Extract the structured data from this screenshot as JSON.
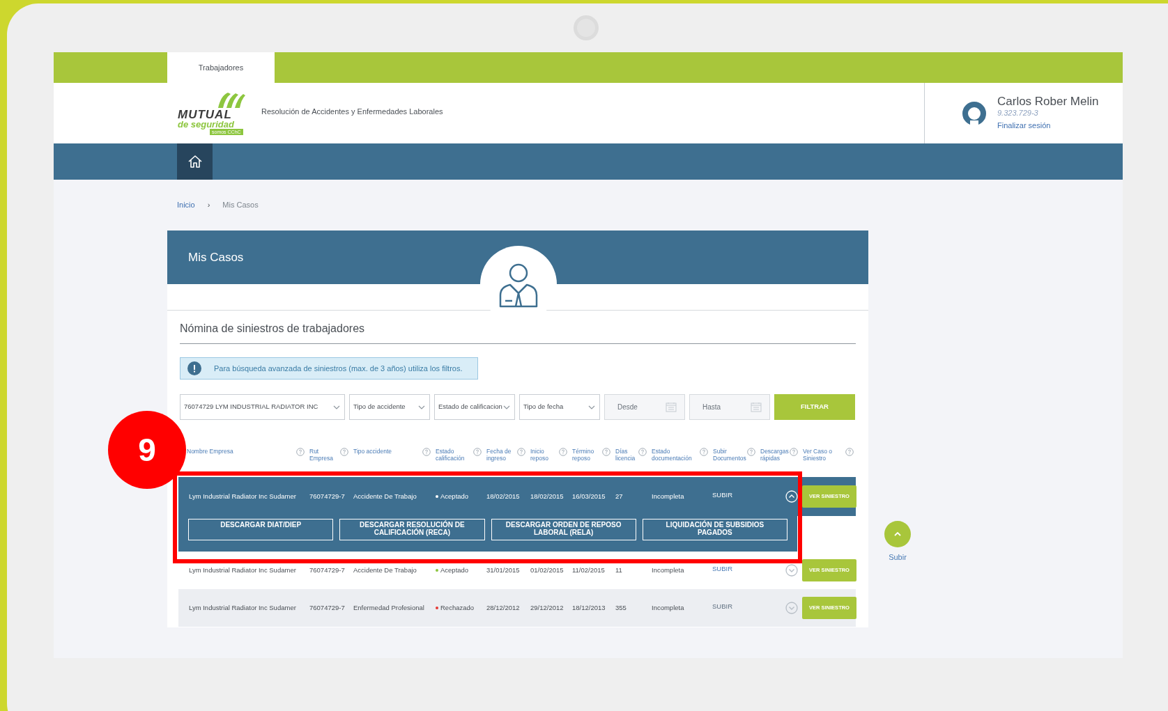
{
  "top_tab": {
    "label": "Trabajadores",
    "selected": true
  },
  "logo": {
    "word": "MUTUAL",
    "sub": "de seguridad",
    "tag": "somos CChC"
  },
  "header": {
    "subtitle": "Resolución de Accidentes y Enfermedades Laborales"
  },
  "user": {
    "name": "Carlos Rober Melin",
    "rut": "9.323.729-3",
    "logout": "Finalizar sesión"
  },
  "breadcrumb": [
    {
      "label": "Inicio",
      "kind": "link"
    },
    {
      "label": "›",
      "kind": "separator"
    },
    {
      "label": "Mis Casos",
      "kind": "current"
    }
  ],
  "card": {
    "title": "Mis Casos",
    "section_title": "Nómina de siniestros de trabajadores"
  },
  "alert": {
    "text": "Para búsqueda avanzada de siniestros (max. de 3 años) utiliza los filtros."
  },
  "filters": [
    {
      "kind": "select",
      "value": "76074729 LYM INDUSTRIAL RADIATOR INC"
    },
    {
      "kind": "select",
      "value": "Tipo de accidente"
    },
    {
      "kind": "select",
      "value": "Estado de calificacion"
    },
    {
      "kind": "select",
      "value": "Tipo de fecha"
    },
    {
      "kind": "date",
      "placeholder": "Desde"
    },
    {
      "kind": "date",
      "placeholder": "Hasta"
    }
  ],
  "filter_button": "FILTRAR",
  "table": {
    "columns": [
      "Nombre Empresa",
      "Rut Empresa",
      "Tipo accidente",
      "Estado calificación",
      "Fecha de ingreso",
      "Inicio reposo",
      "Término reposo",
      "Días licencia",
      "Estado documentación",
      "Subir Documentos",
      "Descargas rápidas",
      "Ver Caso o Siniestro"
    ],
    "rows": [
      {
        "expanded": true,
        "cells": [
          "Lym Industrial Radiator Inc Sudamer",
          "76074729-7",
          "Accidente De Trabajo",
          "Aceptado",
          "18/02/2015",
          "18/02/2015",
          "16/03/2015",
          "27",
          "Incompleta"
        ],
        "color": "#ffffff",
        "upload": "SUBIR",
        "view": "VER SINIESTRO",
        "downloads": [
          "DESCARGAR DIAT/DIEP",
          "DESCARGAR RESOLUCIÓN DE CALIFICACIÓN (RECA)",
          "DESCARGAR ORDEN DE REPOSO LABORAL (RELA)",
          "LIQUIDACIÓN DE SUBSIDIOS PAGADOS"
        ]
      },
      {
        "expanded": false,
        "cells": [
          "Lym Industrial Radiator Inc Sudamer",
          "76074729-7",
          "Accidente De Trabajo",
          "Aceptado",
          "31/01/2015",
          "01/02/2015",
          "11/02/2015",
          "11",
          "Incompleta"
        ],
        "color": "#8dc63f",
        "upload": "SUBIR",
        "view": "VER SINIESTRO"
      },
      {
        "expanded": false,
        "cells": [
          "Lym Industrial Radiator Inc Sudamer",
          "76074729-7",
          "Enfermedad Profesional",
          "Rechazado",
          "28/12/2012",
          "29/12/2012",
          "18/12/2013",
          "355",
          "Incompleta"
        ],
        "color": "#e53935",
        "upload": "SUBIR",
        "view": "VER SINIESTRO"
      }
    ]
  },
  "annotation": {
    "step": "9"
  },
  "scroll_top": {
    "label": "Subir"
  }
}
